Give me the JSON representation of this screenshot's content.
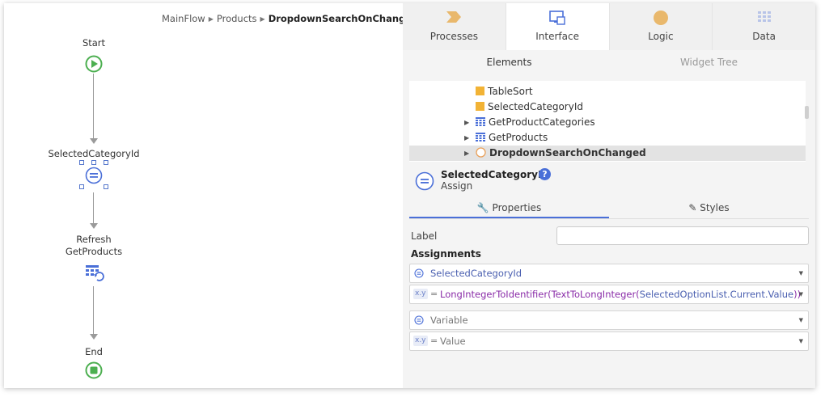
{
  "breadcrumb": {
    "flow": "MainFlow",
    "screen": "Products",
    "action": "DropdownSearchOnChanged"
  },
  "flow": {
    "nodes": [
      {
        "label": "Start",
        "icon": "start-icon"
      },
      {
        "label": "SelectedCategoryId",
        "icon": "assign-icon"
      },
      {
        "label_line1": "Refresh",
        "label_line2": "GetProducts",
        "icon": "refresh-data-icon"
      },
      {
        "label": "End",
        "icon": "end-icon"
      }
    ]
  },
  "panel": {
    "tabs": [
      {
        "label": "Processes",
        "icon": "processes-icon"
      },
      {
        "label": "Interface",
        "icon": "interface-icon"
      },
      {
        "label": "Logic",
        "icon": "logic-icon"
      },
      {
        "label": "Data",
        "icon": "data-icon"
      }
    ],
    "subtabs": [
      {
        "label": "Elements"
      },
      {
        "label": "Widget Tree"
      }
    ],
    "tree": [
      {
        "label": "TableSort",
        "icon": "local-variable-icon"
      },
      {
        "label": "SelectedCategoryId",
        "icon": "local-variable-icon"
      },
      {
        "label": "GetProductCategories",
        "icon": "aggregate-icon"
      },
      {
        "label": "GetProducts",
        "icon": "aggregate-icon"
      },
      {
        "label": "DropdownSearchOnChanged",
        "icon": "client-action-icon"
      }
    ],
    "properties": {
      "title": "SelectedCategoryId",
      "subtitle": "Assign",
      "help": "?",
      "tabs": {
        "properties": "Properties",
        "styles": "Styles"
      },
      "label_field": {
        "label": "Label",
        "value": ""
      },
      "assignments_heading": "Assignments",
      "assignments": [
        {
          "variable": "SelectedCategoryId",
          "value_func1": "LongIntegerToIdentifier",
          "value_func2": "TextToLongInteger",
          "value_param": "SelectedOptionList.Current.Value",
          "value_close": "))"
        },
        {
          "variable_placeholder": "Variable",
          "value_placeholder": "Value"
        }
      ],
      "xy_badge": "x.y",
      "equals": "="
    }
  },
  "colors": {
    "accent": "#4a6fd8",
    "start_end": "#4caf50",
    "folder": "#f2b335",
    "logic": "#e9b86c",
    "expression": "#8a2ca8"
  }
}
